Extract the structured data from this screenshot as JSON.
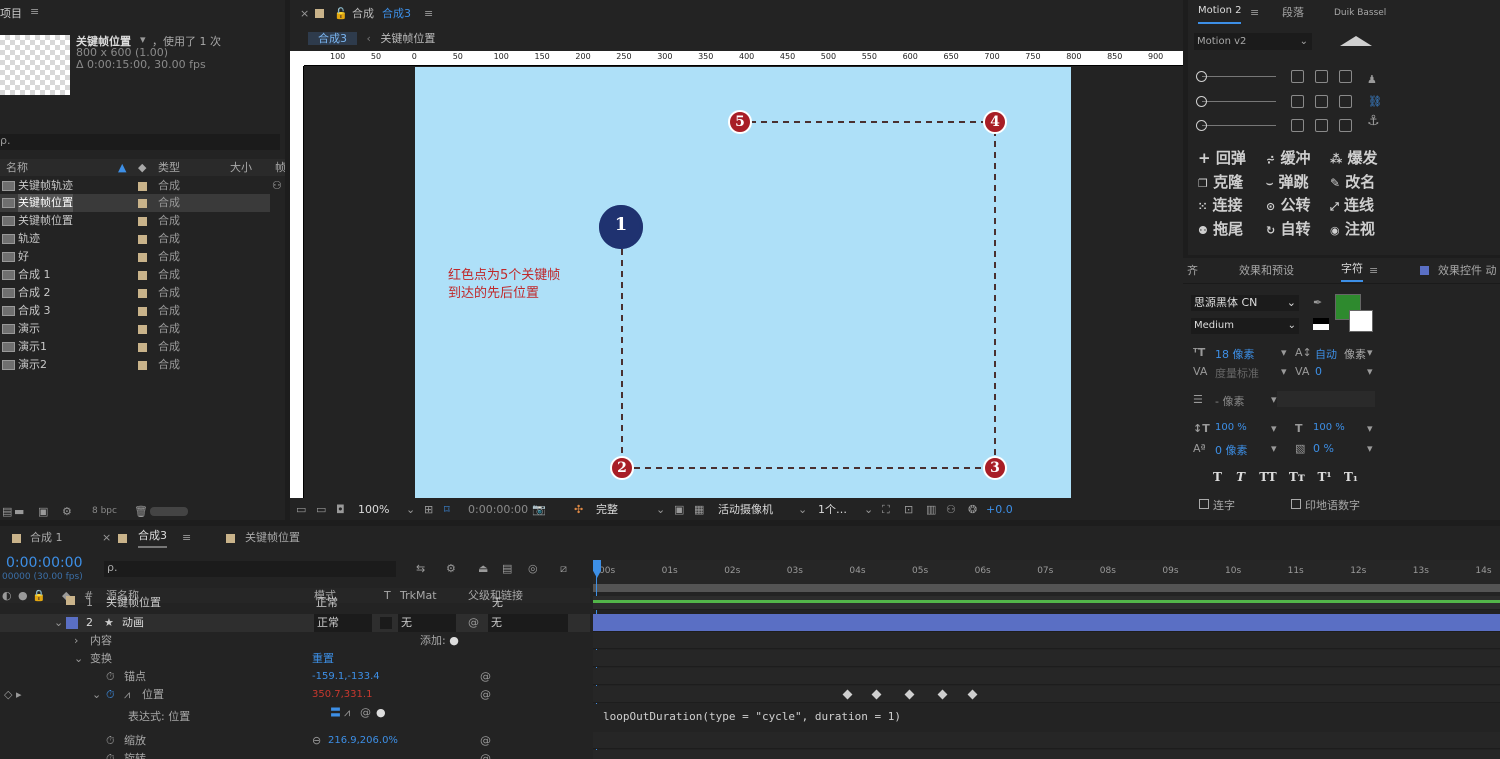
{
  "project": {
    "title": "项目",
    "comp_name": "关键帧位置",
    "used": "，使用了 1 次",
    "dims": "800 x 600 (1.00)",
    "duration": "Δ 0:00:15:00, 30.00 fps",
    "search_placeholder": "ρ.",
    "col_name": "名称",
    "col_type": "类型",
    "col_size": "大小",
    "col_frame": "帧",
    "bpc": "8 bpc",
    "items": [
      {
        "name": "关键帧轨迹",
        "type": "合成"
      },
      {
        "name": "关键帧位置",
        "type": "合成"
      },
      {
        "name": "关键帧位置",
        "type": "合成"
      },
      {
        "name": "轨迹",
        "type": "合成"
      },
      {
        "name": "好",
        "type": "合成"
      },
      {
        "name": "合成 1",
        "type": "合成"
      },
      {
        "name": "合成 2",
        "type": "合成"
      },
      {
        "name": "合成 3",
        "type": "合成"
      },
      {
        "name": "演示",
        "type": "合成"
      },
      {
        "name": "演示1",
        "type": "合成"
      },
      {
        "name": "演示2",
        "type": "合成"
      }
    ]
  },
  "comp": {
    "tab_prefix": "合成",
    "tab_name": "合成3",
    "crumb1": "合成3",
    "crumb2": "关键帧位置",
    "ruler": [
      "100",
      "50",
      "0",
      "50",
      "100",
      "150",
      "200",
      "250",
      "300",
      "350",
      "400",
      "450",
      "500",
      "550",
      "600",
      "650",
      "700",
      "750",
      "800",
      "850",
      "900"
    ],
    "annotation_line1": "红色点为5个关键帧",
    "annotation_line2": "到达的先后位置",
    "markers": [
      "1",
      "2",
      "3",
      "4",
      "5"
    ],
    "zoom": "100%",
    "timecode": "0:00:00:00",
    "resolution": "完整",
    "camera": "活动摄像机",
    "views": "1个…",
    "exposure": "+0.0"
  },
  "motion": {
    "tab1": "Motion 2",
    "tab2": "段落",
    "tab3": "Duik Bassel",
    "preset": "Motion v2",
    "buttons": [
      [
        "回弹",
        "缓冲",
        "爆发"
      ],
      [
        "克隆",
        "弹跳",
        "改名"
      ],
      [
        "连接",
        "公转",
        "连线"
      ],
      [
        "拖尾",
        "自转",
        "注视"
      ]
    ]
  },
  "character": {
    "tab_align": "齐",
    "tab_effects": "效果和预设",
    "tab_char": "字符",
    "tab_fx_controls": "效果控件 动",
    "font": "思源黑体 CN",
    "style": "Medium",
    "size": "18 像素",
    "leading_auto": "自动",
    "leading_unit": "像素",
    "kerning": "度量标准",
    "tracking": "0",
    "stroke": "- 像素",
    "vscale": "100 %",
    "hscale": "100 %",
    "baseline": "0 像素",
    "tsume": "0 %",
    "ligature": "连字",
    "hindi": "印地语数字"
  },
  "timeline": {
    "tab1": "合成 1",
    "tab2": "合成3",
    "tab3": "关键帧位置",
    "timecode": "0:00:00:00",
    "fps": "00000 (30.00 fps)",
    "search": "ρ.",
    "col_source": "源名称",
    "col_mode": "模式",
    "col_t": "T",
    "col_trkmat": "TrkMat",
    "col_parent": "父级和链接",
    "ticks": [
      "00s",
      "01s",
      "02s",
      "03s",
      "04s",
      "05s",
      "06s",
      "07s",
      "08s",
      "09s",
      "10s",
      "11s",
      "12s",
      "13s",
      "14s"
    ],
    "layer1": {
      "num": "1",
      "name": "关键帧位置",
      "mode": "正常",
      "parent": "无"
    },
    "layer2": {
      "num": "2",
      "name": "动画",
      "mode": "正常",
      "trkmat": "无",
      "parent": "无"
    },
    "contents": "内容",
    "add": "添加:",
    "transform": "变换",
    "reset": "重置",
    "anchor_label": "锚点",
    "anchor_value": "-159.1,-133.4",
    "position_label": "位置",
    "position_value": "350.7,331.1",
    "expr_label": "表达式: 位置",
    "expression": "loopOutDuration(type = \"cycle\", duration = 1)",
    "scale_label": "缩放",
    "scale_value": "216.9,206.0%",
    "rotation_label": "旋转"
  },
  "colors": {
    "accent": "#3d8fe6",
    "canvas": "#aee0f8",
    "marker": "#a81e26",
    "marker_top": "#1f3270",
    "layer": "#5a6fc4"
  }
}
